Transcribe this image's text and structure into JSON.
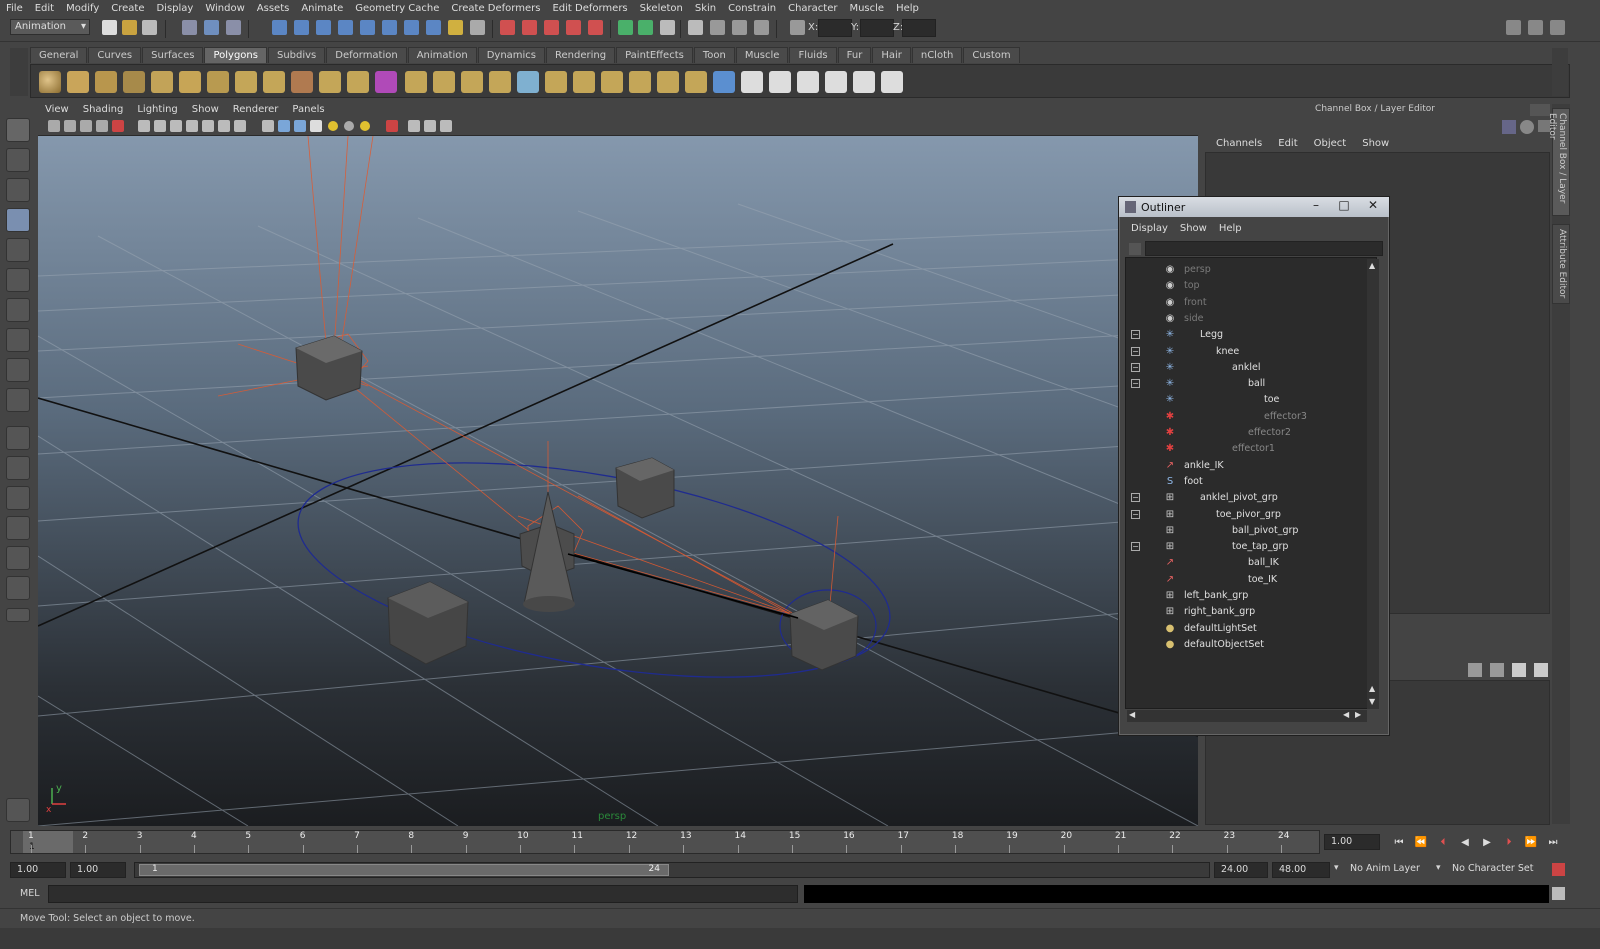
{
  "menubar": [
    "File",
    "Edit",
    "Modify",
    "Create",
    "Display",
    "Window",
    "Assets",
    "Animate",
    "Geometry Cache",
    "Create Deformers",
    "Edit Deformers",
    "Skeleton",
    "Skin",
    "Constrain",
    "Character",
    "Muscle",
    "Help"
  ],
  "statusline": {
    "menu_set": "Animation",
    "x_label": "X:",
    "y_label": "Y:",
    "z_label": "Z:"
  },
  "shelf_tabs": [
    "General",
    "Curves",
    "Surfaces",
    "Polygons",
    "Subdivs",
    "Deformation",
    "Animation",
    "Dynamics",
    "Rendering",
    "PaintEffects",
    "Toon",
    "Muscle",
    "Fluids",
    "Fur",
    "Hair",
    "nCloth",
    "Custom"
  ],
  "shelf_active": "Polygons",
  "viewport": {
    "menu": [
      "View",
      "Shading",
      "Lighting",
      "Show",
      "Renderer",
      "Panels"
    ],
    "camera_label": "persp",
    "axis_x": "x",
    "axis_y": "y"
  },
  "channelbox": {
    "title": "Channel Box / Layer Editor",
    "menu": [
      "Channels",
      "Edit",
      "Object",
      "Show"
    ]
  },
  "side_tabs": [
    "Channel Box / Layer Editor",
    "Attribute Editor"
  ],
  "outliner": {
    "title": "Outliner",
    "menu": [
      "Display",
      "Show",
      "Help"
    ],
    "items": [
      {
        "label": "persp",
        "indent": 0,
        "icon": "camera-icon",
        "style": "dim",
        "exp": ""
      },
      {
        "label": "top",
        "indent": 0,
        "icon": "camera-icon",
        "style": "dim",
        "exp": ""
      },
      {
        "label": "front",
        "indent": 0,
        "icon": "camera-icon",
        "style": "dim",
        "exp": ""
      },
      {
        "label": "side",
        "indent": 0,
        "icon": "camera-icon",
        "style": "dim",
        "exp": ""
      },
      {
        "label": "Legg",
        "indent": 1,
        "icon": "joint-icon",
        "style": "",
        "exp": "−"
      },
      {
        "label": "knee",
        "indent": 2,
        "icon": "joint-icon",
        "style": "",
        "exp": "−"
      },
      {
        "label": "anklel",
        "indent": 3,
        "icon": "joint-icon",
        "style": "",
        "exp": "−"
      },
      {
        "label": "ball",
        "indent": 4,
        "icon": "joint-icon",
        "style": "",
        "exp": "−"
      },
      {
        "label": "toe",
        "indent": 5,
        "icon": "joint-icon",
        "style": "",
        "exp": ""
      },
      {
        "label": "effector3",
        "indent": 5,
        "icon": "effector-icon",
        "style": "faded",
        "exp": ""
      },
      {
        "label": "effector2",
        "indent": 4,
        "icon": "effector-icon",
        "style": "faded",
        "exp": ""
      },
      {
        "label": "effector1",
        "indent": 3,
        "icon": "effector-icon",
        "style": "faded",
        "exp": ""
      },
      {
        "label": "ankle_IK",
        "indent": 0,
        "icon": "ik-handle-icon",
        "style": "",
        "exp": ""
      },
      {
        "label": "foot",
        "indent": 0,
        "icon": "curve-icon",
        "style": "",
        "exp": ""
      },
      {
        "label": "anklel_pivot_grp",
        "indent": 1,
        "icon": "group-icon",
        "style": "",
        "exp": "−"
      },
      {
        "label": "toe_pivor_grp",
        "indent": 2,
        "icon": "group-icon",
        "style": "",
        "exp": "−"
      },
      {
        "label": "ball_pivot_grp",
        "indent": 3,
        "icon": "group-icon",
        "style": "",
        "exp": ""
      },
      {
        "label": "toe_tap_grp",
        "indent": 3,
        "icon": "group-icon",
        "style": "",
        "exp": "−"
      },
      {
        "label": "ball_IK",
        "indent": 4,
        "icon": "ik-handle-icon",
        "style": "",
        "exp": ""
      },
      {
        "label": "toe_IK",
        "indent": 4,
        "icon": "ik-handle-icon",
        "style": "",
        "exp": ""
      },
      {
        "label": "left_bank_grp",
        "indent": 0,
        "icon": "group-icon",
        "style": "",
        "exp": ""
      },
      {
        "label": "right_bank_grp",
        "indent": 0,
        "icon": "group-icon",
        "style": "",
        "exp": ""
      },
      {
        "label": "defaultLightSet",
        "indent": 0,
        "icon": "set-icon",
        "style": "",
        "exp": ""
      },
      {
        "label": "defaultObjectSet",
        "indent": 0,
        "icon": "set-icon",
        "style": "",
        "exp": ""
      }
    ]
  },
  "timeline": {
    "ticks": [
      "1",
      "2",
      "3",
      "4",
      "5",
      "6",
      "7",
      "8",
      "9",
      "10",
      "11",
      "12",
      "13",
      "14",
      "15",
      "16",
      "17",
      "18",
      "19",
      "20",
      "21",
      "22",
      "23",
      "24"
    ],
    "current_frame": "1",
    "current_time_field": "1.00"
  },
  "range": {
    "start_time": "1.00",
    "playback_start": "1.00",
    "slider_start": "1",
    "slider_end": "24",
    "playback_end": "24.00",
    "end_time": "48.00",
    "anim_layer": "No Anim Layer",
    "character_set": "No Character Set"
  },
  "cmdline": {
    "label": "MEL"
  },
  "helpline": {
    "text": "Move Tool: Select an object to move."
  },
  "colors": {
    "accent": "#e05a30",
    "selection": "#1f2b8f",
    "grid": "#8a97a6"
  }
}
